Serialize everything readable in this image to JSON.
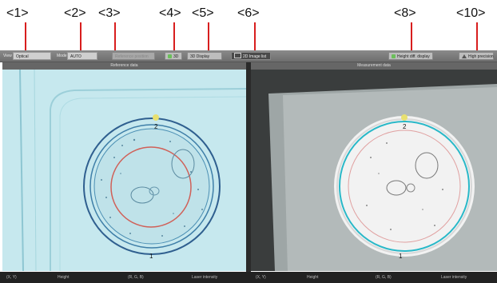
{
  "callouts": [
    "<1>",
    "<2>",
    "<3>",
    "<4>",
    "<5>",
    "<6>",
    "<8>",
    "<10>"
  ],
  "toolbar": {
    "view_label": "View",
    "view_value": "Optical",
    "mode_label": "Mode",
    "mode_value": "AUTO",
    "reference_button": "Reference position",
    "button_3d": "3D",
    "button_3d_display": "3D Display",
    "button_2d_image": "2D Image list",
    "height_diff_display": "Height diff. display",
    "high_precision": "High precision"
  },
  "panels": {
    "left_title": "Reference data",
    "right_title": "Measurement data"
  },
  "markers": {
    "left_top": "2",
    "left_bottom": "1",
    "right_top": "2",
    "right_bottom": "1"
  },
  "bottom": {
    "left": [
      "(X, Y)",
      "Height",
      "(R, G, B)",
      "Laser intensity"
    ],
    "right": [
      "(X, Y)",
      "Height",
      "(R, G, B)",
      "Laser intensity"
    ]
  },
  "colors": {
    "callout_line": "#d81e1e",
    "left_bg": "#c6e8ee",
    "ring_outer": "#2f5f8f",
    "ring_inner": "#d06058",
    "cyan_ring": "#28b8c8"
  }
}
